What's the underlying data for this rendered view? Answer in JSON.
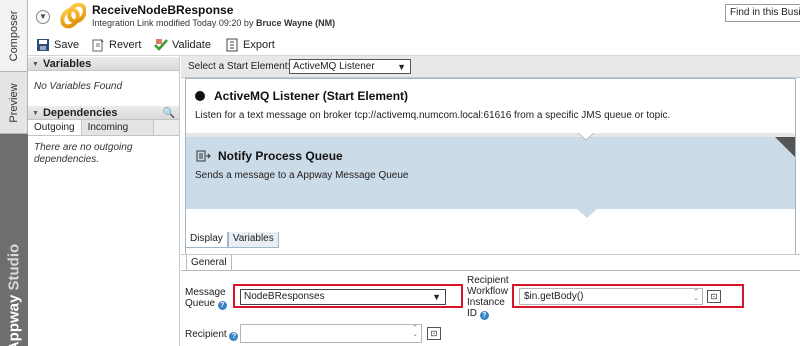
{
  "side_tabs": {
    "composer": "Composer",
    "preview": "Preview",
    "brand_a": "Appway",
    "brand_b": "Studio"
  },
  "header": {
    "title": "ReceiveNodeBResponse",
    "subtitle_prefix": "Integration Link modified Today 09:20 by ",
    "subtitle_user": "Bruce Wayne (NM)",
    "find_placeholder": "Find in this Business"
  },
  "toolbar": {
    "save": "Save",
    "revert": "Revert",
    "validate": "Validate",
    "export": "Export"
  },
  "left_panel": {
    "variables_title": "Variables",
    "variables_empty": "No Variables Found",
    "dependencies_title": "Dependencies",
    "tabs": [
      "Outgoing",
      "Incoming"
    ],
    "dependencies_empty": "There are no outgoing dependencies."
  },
  "canvas": {
    "start_label": "Select a Start Element:",
    "start_value": "ActiveMQ Listener",
    "steps": [
      {
        "name": "ActiveMQ Listener (Start Element)",
        "desc": "Listen for a text message on broker tcp://activemq.numcom.local:61616 from a specific JMS queue or topic."
      },
      {
        "name": "Notify Process Queue",
        "desc": "Sends a message to a Appway Message Queue"
      }
    ],
    "tabs": [
      "Display",
      "Variables"
    ]
  },
  "properties": {
    "tab": "General",
    "message_queue_label_1": "Message",
    "message_queue_label_2": "Queue",
    "message_queue_value": "NodeBResponses",
    "recipient_wf_label_1": "Recipient",
    "recipient_wf_label_2": "Workflow",
    "recipient_wf_label_3": "Instance",
    "recipient_wf_label_4": "ID",
    "recipient_wf_value": "$in.getBody()",
    "recipient_label": "Recipient",
    "recipient_value": ""
  },
  "colors": {
    "highlight": "#d7142a",
    "selected_step": "#cbdbe8",
    "help": "#3a83c6"
  }
}
